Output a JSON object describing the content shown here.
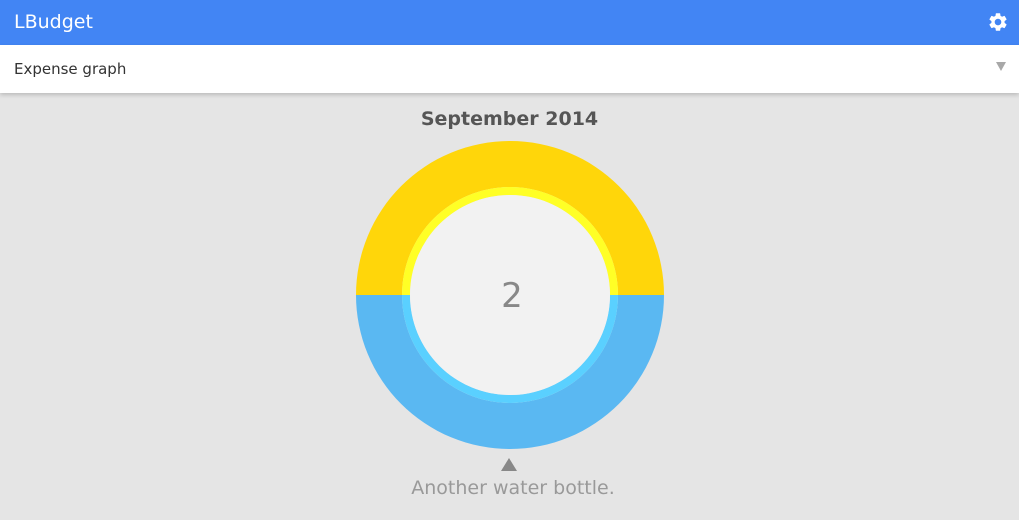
{
  "app": {
    "title": "LBudget",
    "settings_icon": "gear-icon"
  },
  "view_selector": {
    "selected": "Expense graph",
    "dropdown_icon": "dropdown-triangle-icon"
  },
  "graph": {
    "month": "September 2014",
    "center_value": "2",
    "selected_item": "Another water bottle.",
    "pointer_icon": "triangle-up-icon",
    "segments": [
      {
        "fraction": 0.5,
        "color": "#ffd60a",
        "inner_color": "#ffff26"
      },
      {
        "fraction": 0.5,
        "color": "#5ab8f2",
        "inner_color": "#5ad0ff"
      }
    ],
    "center_color": "#f2f2f2"
  },
  "colors": {
    "appbar": "#4285f4",
    "background": "#e5e5e5"
  }
}
